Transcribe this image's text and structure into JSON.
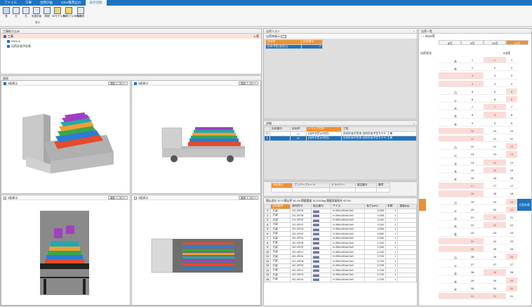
{
  "menubar": {
    "items": [
      "ファイル",
      "工事",
      "出荷計画",
      "CSV/帳票出力",
      "表示切替"
    ],
    "active_index": 4
  },
  "ribbon": {
    "buttons": [
      "表",
      "左",
      "右",
      "年度計画",
      "明細",
      "3Dモデル表示",
      "3Dモデル非表示",
      "手順書"
    ],
    "group_label": "表示"
  },
  "worklist": {
    "title": "工事絞り込み",
    "right_label": "入替",
    "rows": [
      "工事",
      "0001-A",
      "出荷計画予定表"
    ]
  },
  "views": {
    "title": "画面",
    "v1": {
      "label": "3面表示",
      "btn1": "保存",
      "btn2": "コピー"
    },
    "v2": {
      "label": "3面表示",
      "btn1": "保存",
      "btn2": "コピー"
    },
    "v3": {
      "label": "3面表示",
      "btn1": "保存",
      "btn2": "コピー"
    },
    "v4": {
      "label": "3面表示",
      "btn1": "保存",
      "btn2": "コピー"
    }
  },
  "shiplist": {
    "title": "出荷リスト",
    "filter_label": "出荷済表示",
    "cols": [
      "出荷先",
      "出荷番号"
    ],
    "rows": [
      [
        "出荷予定(出荷日)",
        "2"
      ]
    ]
  },
  "detail": {
    "title": "詳細",
    "cols": [
      "出荷番号",
      "出荷済",
      "トラック名称",
      "工程"
    ],
    "rows": [
      [
        "1",
        "",
        "(出荷予定)(1台目)",
        "出荷計画予定表 出荷計画予定モデル 工事"
      ],
      [
        "2",
        "",
        "(出荷予定)(1台目)",
        "出荷計画予定表 出荷計画予定モデル 工事"
      ]
    ]
  },
  "truck_info": {
    "cols": [
      "車両番号",
      "ナンバープレート",
      "ドライバー",
      "電話番号",
      "備考"
    ]
  },
  "summary": "積込合計 10.7t  積込率 16.1%  積載重量 14,218.5kg  積載容量割合 42.3%",
  "members": {
    "cols": [
      "",
      "出荷順序",
      "部材符号",
      "製品番号",
      "サイズ",
      "長さ(mm)",
      "本数",
      "重量(kg)"
    ],
    "rows": [
      [
        "1",
        "大梁",
        "2G-1RYA",
        "▆▆▆",
        "H-390x150x6.5x9",
        "3,055",
        "1",
        ""
      ],
      [
        "2",
        "大梁",
        "2G-1RYB",
        "▆▆▆",
        "H-390x150x6.5x9",
        "3,055",
        "1",
        ""
      ],
      [
        "3",
        "大梁",
        "2G-1RYE",
        "▆▆▆",
        "H-390x150x6.5x9",
        "3,150",
        "1",
        ""
      ],
      [
        "4",
        "大梁",
        "2G-1RYC",
        "▆▆▆",
        "H-390x150x6.5x9",
        "3,150",
        "1",
        ""
      ],
      [
        "5",
        "大梁",
        "2G-1RYD",
        "▆▆▆",
        "H-390x150x6.5x9",
        "3,555",
        "1",
        ""
      ],
      [
        "6",
        "大梁",
        "3G-1RYE",
        "▆▆▆",
        "H-390x150x6.5x9",
        "3,555",
        "1",
        ""
      ],
      [
        "7",
        "大梁",
        "3G-1RYA",
        "▆▆▆",
        "H-390x150x6.5x9",
        "2,230",
        "1",
        ""
      ],
      [
        "8",
        "大梁",
        "3G-1RYB",
        "▆▆▆",
        "H-390x150x6.5x9",
        "2,230",
        "1",
        ""
      ],
      [
        "9",
        "大梁",
        "3G-1RYE",
        "▆▆▆",
        "H-390x150x6.5x9",
        "2,150",
        "1",
        ""
      ],
      [
        "10",
        "大梁",
        "3G-1RYC",
        "▆▆▆",
        "H-390x150x6.5x9",
        "2,150",
        "1",
        ""
      ],
      [
        "11",
        "大梁",
        "4G-1RYA",
        "▆▆▆",
        "H-390x150x6.5x9",
        "3,700",
        "1",
        ""
      ],
      [
        "12",
        "大梁",
        "4G-1RYB",
        "▆▆▆",
        "H-390x150x6.5x9",
        "3,700",
        "1",
        ""
      ],
      [
        "13",
        "大梁",
        "4G-1RYE",
        "▆▆▆",
        "H-390x150x6.5x9",
        "3,705",
        "1",
        ""
      ],
      [
        "14",
        "大梁",
        "4G-1RYC",
        "▆▆▆",
        "H-390x150x6.5x9",
        "3,705",
        "1",
        ""
      ],
      [
        "15",
        "大梁",
        "4G-1RYD",
        "▆▆▆",
        "H-390x150x6.5x9",
        "3,705",
        "1",
        ""
      ],
      [
        "16",
        "大梁",
        "5G-1RYA",
        "▆▆▆",
        "H-390x150x6.5x9",
        "3,705",
        "1",
        ""
      ]
    ]
  },
  "calendar": {
    "title": "出荷一覧",
    "year": "2024年",
    "months": [
      "8月",
      "9月",
      "10月",
      "11月"
    ],
    "current_month_index": 3,
    "row_header": "出荷状況",
    "badge": "6出荷",
    "truck_cell": "大型台車",
    "days": [
      "1",
      "2",
      "3",
      "4",
      "5",
      "6",
      "7",
      "8",
      "9",
      "10",
      "11",
      "12",
      "13",
      "14",
      "15",
      "16",
      "17",
      "18",
      "19",
      "20",
      "21",
      "22",
      "23",
      "24",
      "25",
      "26",
      "27",
      "28",
      "29",
      "30",
      "31"
    ],
    "weekdays": [
      "木",
      "金",
      "土",
      "日",
      "月",
      "火",
      "水",
      "木",
      "金",
      "土",
      "日",
      "月",
      "火",
      "水",
      "木",
      "金",
      "土",
      "日",
      "月",
      "火",
      "水",
      "木",
      "金",
      "土",
      "日",
      "月",
      "火",
      "水",
      "木",
      "金",
      "土"
    ]
  },
  "colors": {
    "accent": "#1e73be",
    "orange": "#f09030",
    "pink": "#fadcd8"
  }
}
